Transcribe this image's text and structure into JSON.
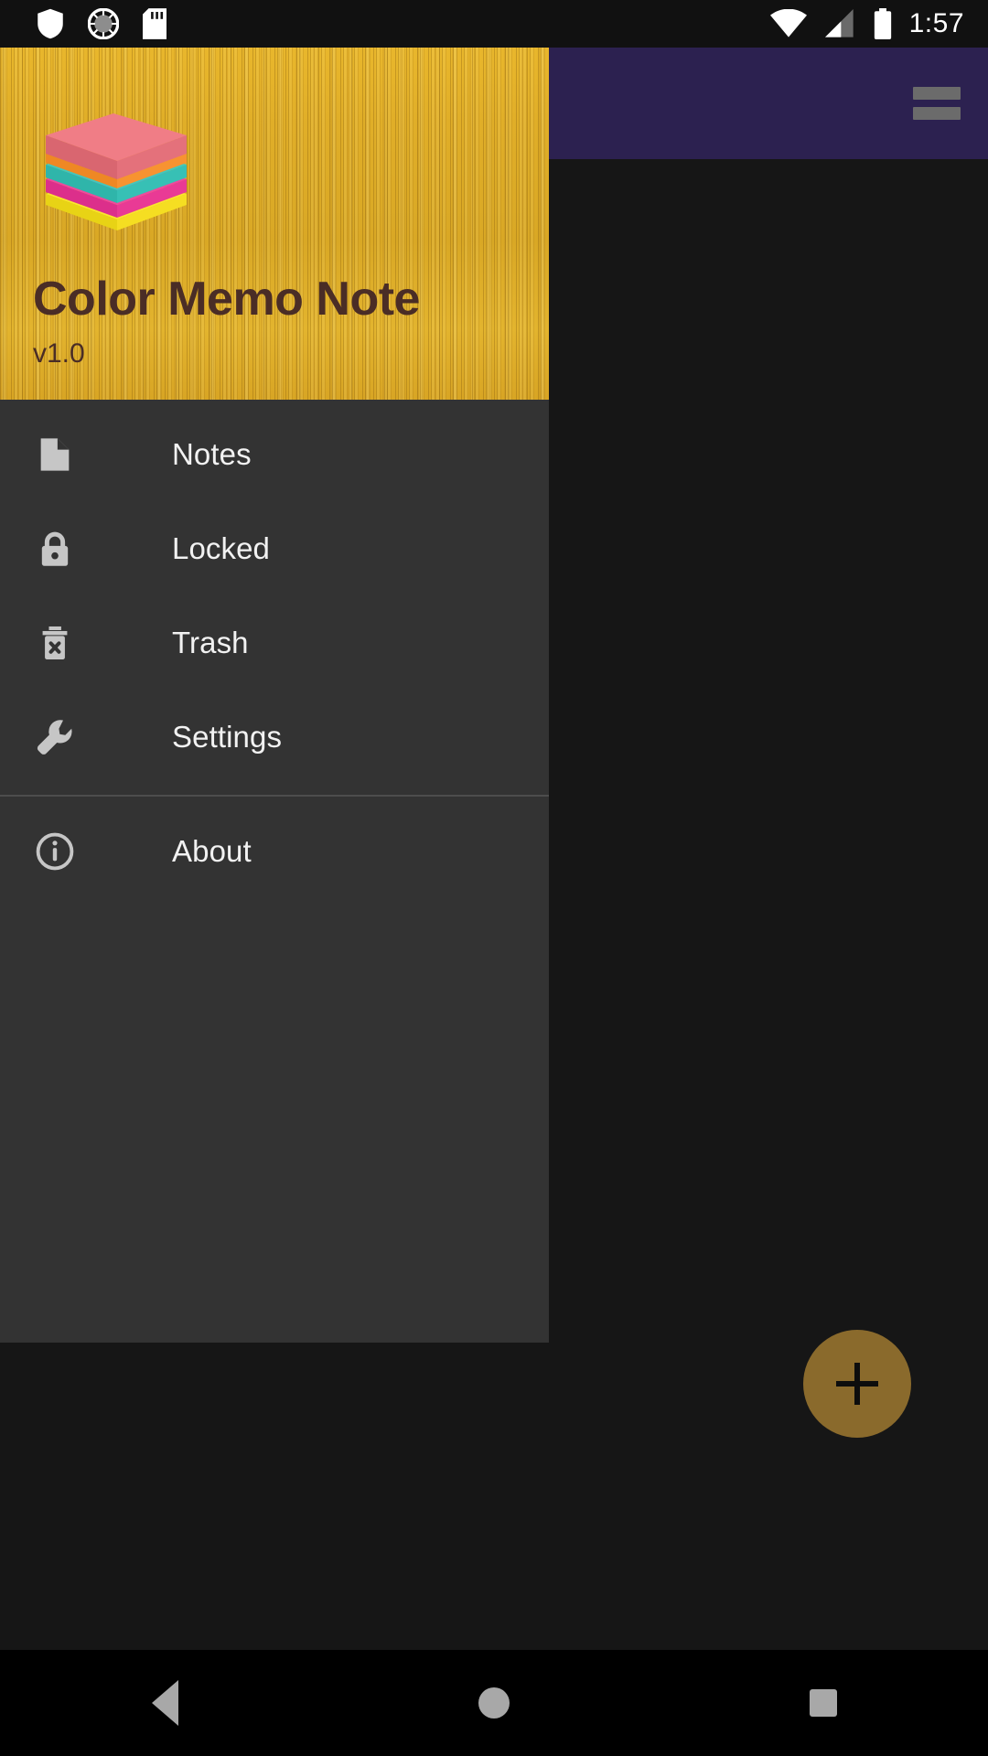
{
  "status_bar": {
    "icons_left": [
      "shield-icon",
      "sync-spinner-icon",
      "sd-card-icon"
    ],
    "icons_right": [
      "wifi-icon",
      "cell-signal-icon",
      "battery-icon"
    ],
    "time": "1:57"
  },
  "toolbar": {
    "background_color": "#2C2150",
    "overflow_label": "overflow-menu"
  },
  "drawer": {
    "header": {
      "app_title": "Color Memo Note",
      "version": "v1.0",
      "title_color": "#4A2D26",
      "background": "wood-texture-gold",
      "logo": {
        "name": "sticky-note-stack-logo",
        "layer_colors": [
          "#F07D86",
          "#FF9D3C",
          "#3FC9BE",
          "#F0479F",
          "#FAE62D"
        ]
      }
    },
    "menu": [
      {
        "id": "notes",
        "label": "Notes",
        "icon": "document-icon"
      },
      {
        "id": "locked",
        "label": "Locked",
        "icon": "lock-icon"
      },
      {
        "id": "trash",
        "label": "Trash",
        "icon": "trash-delete-icon"
      },
      {
        "id": "settings",
        "label": "Settings",
        "icon": "wrench-icon"
      }
    ],
    "menu_bottom": [
      {
        "id": "about",
        "label": "About",
        "icon": "info-circle-icon"
      }
    ],
    "background_color": "#333333",
    "label_color": "#F2F2F2",
    "icon_color": "#C6C6C6"
  },
  "content": {
    "fab": {
      "label": "+",
      "icon": "plus-icon",
      "color": "#8A6A2C"
    },
    "background_color": "#161616"
  },
  "nav_bar": {
    "back": "back-icon",
    "home": "home-icon",
    "recents": "recents-icon"
  }
}
